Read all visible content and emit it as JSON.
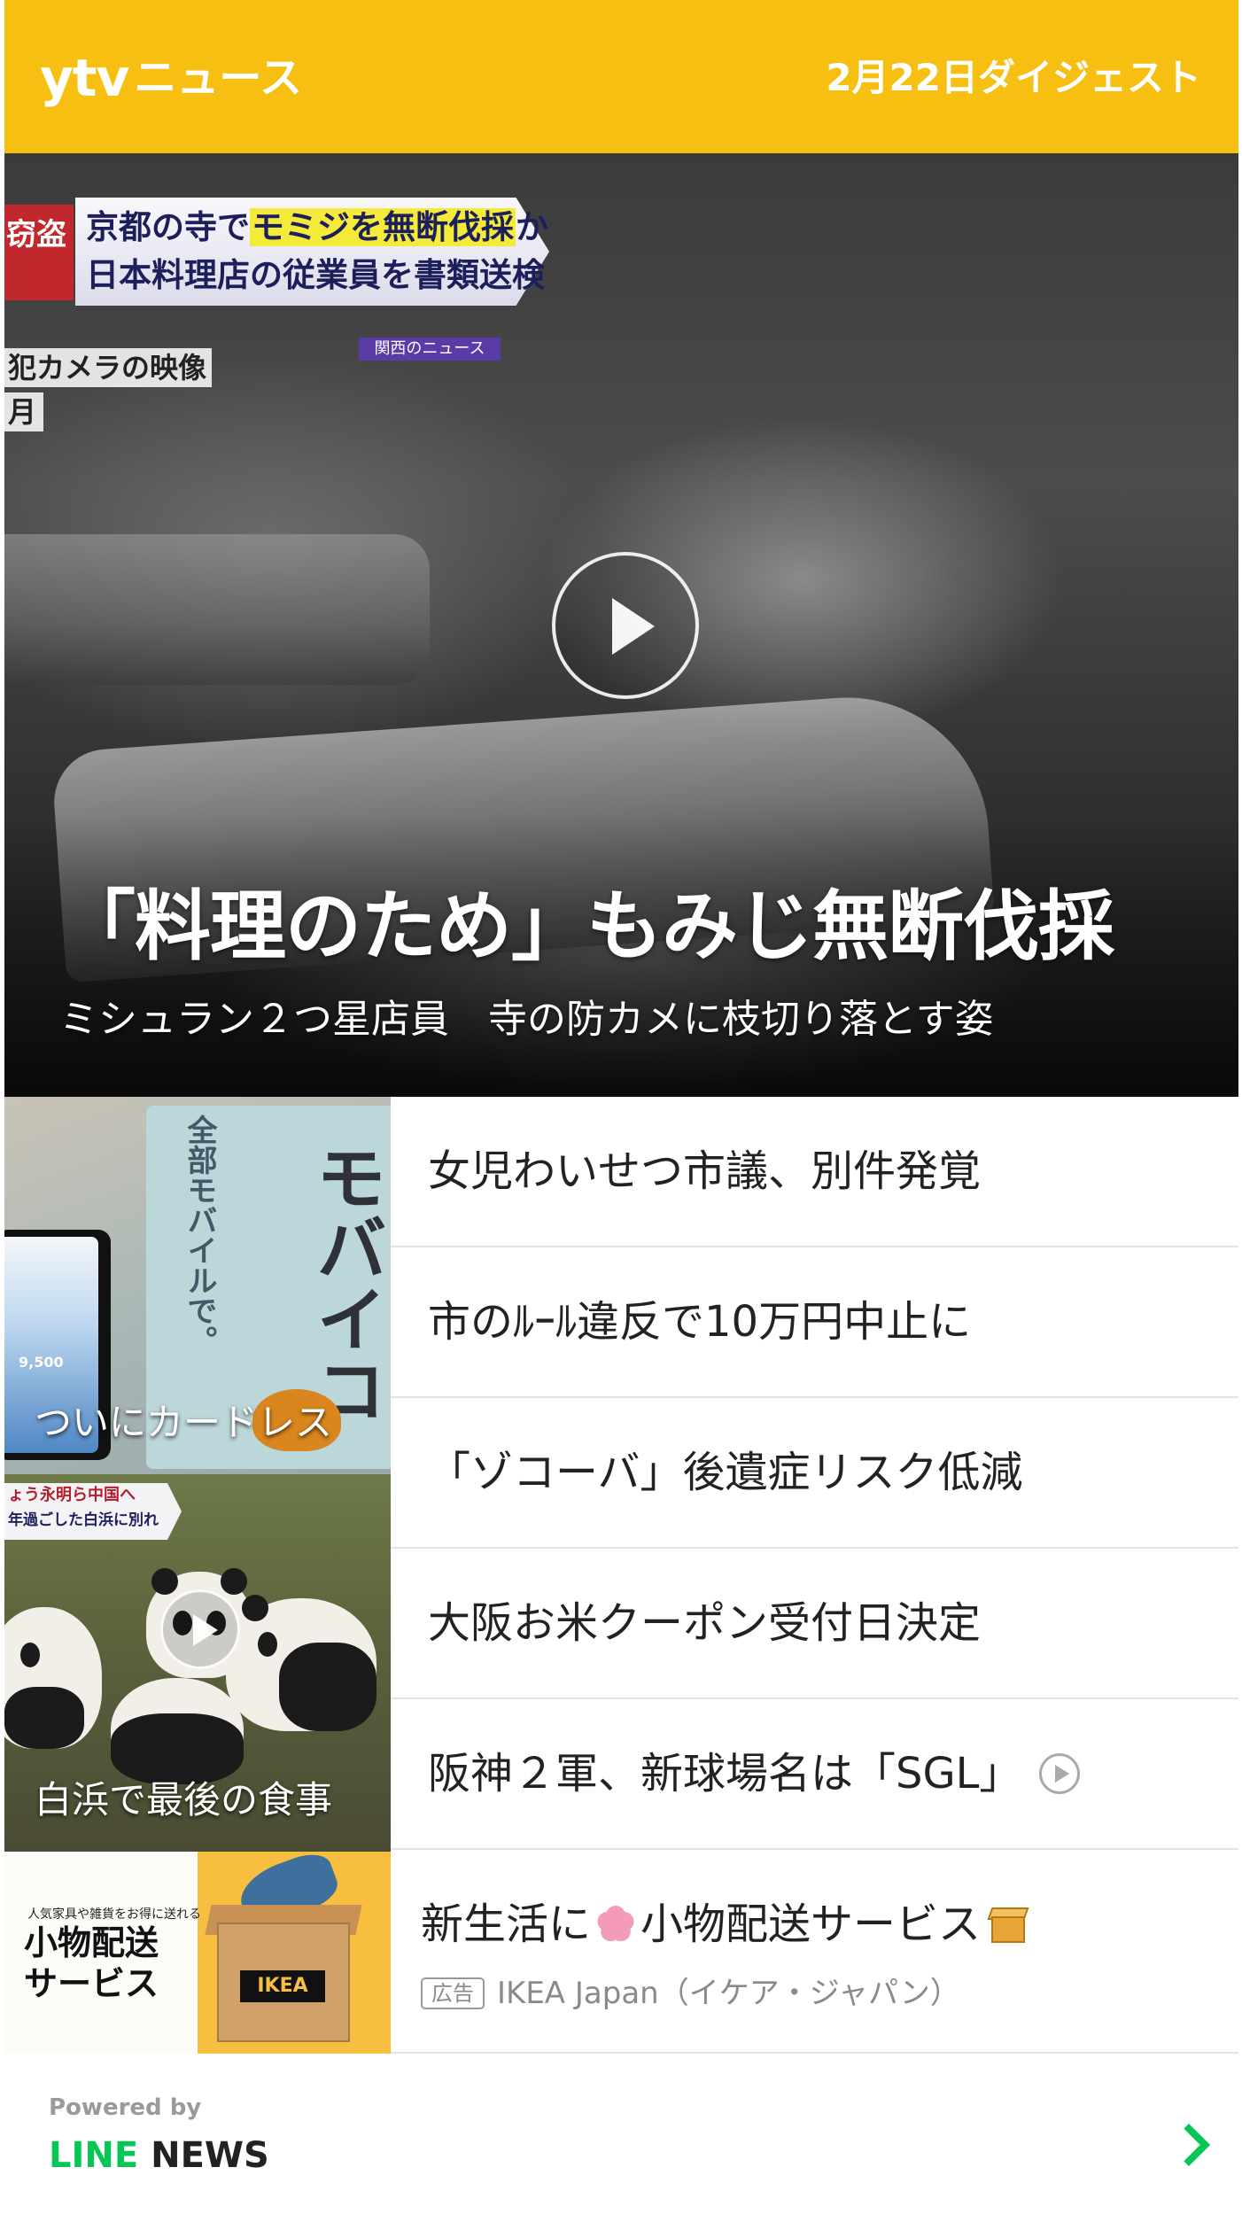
{
  "header": {
    "logo_ytv": "ytv",
    "logo_news": "ニュース",
    "digest_label": "2月22日ダイジェスト",
    "bg_color": "#F7BF12"
  },
  "hero": {
    "telop": {
      "tag": "窃盗",
      "line1_pre": "京都の寺で",
      "line1_highlight": "モミジを無断伐採",
      "line1_post": "か",
      "line2": "日本料理店の従業員を書類送検",
      "source": "関西のニュース",
      "caption1": "犯カメラの映像",
      "caption2": "月"
    },
    "title": "「料理のため」もみじ無断伐採",
    "subtitle": "ミシュラン２つ星店員　寺の防カメに枝切り落とす姿",
    "has_video": true
  },
  "thumbs": {
    "card": {
      "caption": "ついにカードレス",
      "poster_vertical": "全部モバイルで。",
      "poster_big": "モバイコ",
      "phone_price": "9,500"
    },
    "panda": {
      "caption": "白浜で最後の食事",
      "telop1": "ょう永明ら中国へ",
      "telop2": "年過ごした白浜に別れ",
      "has_video": true
    }
  },
  "headlines": [
    {
      "text": "女児わいせつ市議、別件発覚",
      "video": false
    },
    {
      "text": "市のﾙｰﾙ違反で10万円中止に",
      "video": false
    },
    {
      "text": "「ゾコーバ」後遺症リスク低減",
      "video": false
    },
    {
      "text": "大阪お米クーポン受付日決定",
      "video": false
    },
    {
      "text": "阪神２軍、新球場名は「SGL」",
      "video": true
    }
  ],
  "ad": {
    "title_pre": "新生活に",
    "title_post": "小物配送サービス",
    "badge": "広告",
    "sponsor": "IKEA Japan（イケア・ジャパン）",
    "thumb_small": "人気家具や雑貨をお得に送れる",
    "thumb_big1": "小物配送",
    "thumb_big2": "サービス",
    "thumb_logo": "IKEA"
  },
  "footer": {
    "powered_by": "Powered by",
    "brand_line": "LINE",
    "brand_news": " NEWS",
    "accent_color": "#06C755"
  }
}
